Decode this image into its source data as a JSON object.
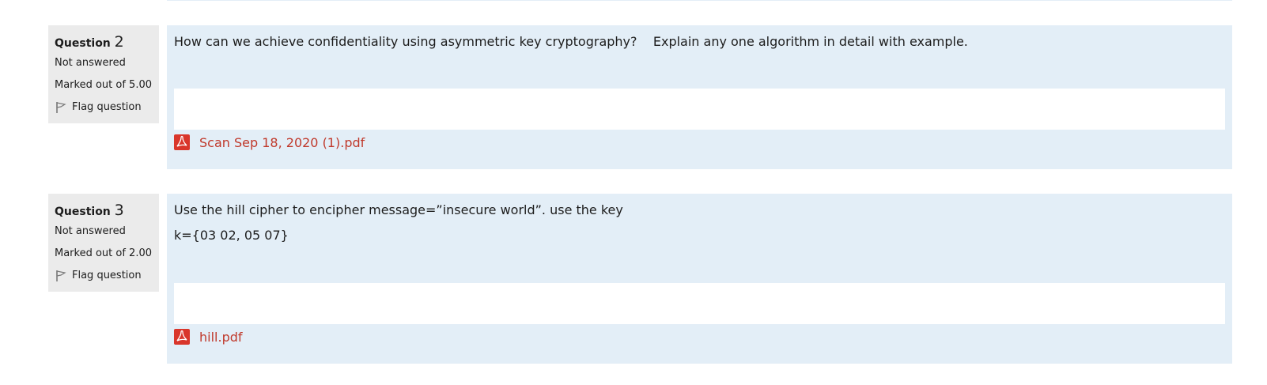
{
  "questions": [
    {
      "label": "Question",
      "number": "2",
      "state": "Not answered",
      "grade": "Marked out of 5.00",
      "flag_label": "Flag question",
      "text_lines": [
        "How can we achieve confidentiality using asymmetric key cryptography?    Explain any one algorithm in detail with example."
      ],
      "attachment": "Scan Sep 18, 2020 (1).pdf"
    },
    {
      "label": "Question",
      "number": "3",
      "state": "Not answered",
      "grade": "Marked out of 2.00",
      "flag_label": "Flag question",
      "text_lines": [
        "Use the hill cipher to encipher message=”insecure world”. use the key",
        "k={03 02, 05 07}"
      ],
      "attachment": "hill.pdf"
    }
  ],
  "colors": {
    "info_bg": "#ebebeb",
    "content_bg": "#e3eef7",
    "link": "#c0392b",
    "pdf_icon": "#d9362b"
  },
  "icons": {
    "flag": "flag-icon",
    "attachment": "pdf-icon"
  }
}
